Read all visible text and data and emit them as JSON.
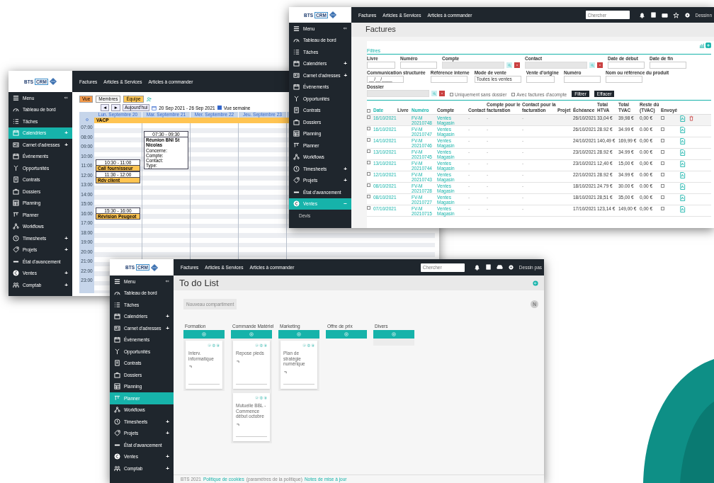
{
  "windows": [
    {
      "kind": "calendar",
      "logo": [
        "BTS",
        "CRM"
      ],
      "nav": [
        "Factures",
        "Articles & Services",
        "Articles à commander"
      ],
      "sidebar": {
        "menu_label": "Menu",
        "items": [
          {
            "label": "Tableau de bord",
            "selected": false
          },
          {
            "label": "Tâches",
            "selected": false
          },
          {
            "label": "Calendriers",
            "toggle": "+",
            "selected": true
          },
          {
            "label": "Carnet d'adresses",
            "toggle": "+",
            "selected": false
          },
          {
            "label": "Événements",
            "selected": false
          },
          {
            "label": "Opportunités",
            "selected": false
          },
          {
            "label": "Contrats",
            "selected": false
          },
          {
            "label": "Dossiers",
            "selected": false
          },
          {
            "label": "Planning",
            "selected": false
          },
          {
            "label": "Planner",
            "selected": false
          },
          {
            "label": "Workflows",
            "selected": false
          },
          {
            "label": "Timesheets",
            "toggle": "+",
            "selected": false
          },
          {
            "label": "Projets",
            "toggle": "+",
            "selected": false
          },
          {
            "label": "État d'avancement",
            "selected": false
          },
          {
            "label": "Ventes",
            "toggle": "+",
            "selected": false
          },
          {
            "label": "Comptab",
            "toggle": "+",
            "selected": false
          }
        ]
      },
      "calendar": {
        "views": [
          {
            "label": "Vue",
            "color": "#f59a4a"
          },
          {
            "label": "Membres",
            "color": "#ffffff"
          },
          {
            "label": "Équipe",
            "color": "#ffc857"
          }
        ],
        "prev": "◄",
        "next": "►",
        "today": "Aujourd'hui",
        "range": "20 Sep 2021 - 26 Sep 2021",
        "week_toggle": {
          "label": "Vue semaine",
          "checked": true
        },
        "days": [
          {
            "label": "Lun. Septembre 20",
            "events": [
              {
                "time": "10:30 - 11:00",
                "title": "Call fournisseur"
              },
              {
                "time": "11:30 - 12:00",
                "title": "Rdv client"
              },
              {
                "time": "15:30 - 16:00",
                "title": "Révision Peugeot"
              }
            ]
          },
          {
            "label": "Mar. Septembre 21",
            "events": [
              {
                "time": "07:30 - 09:30",
                "title": "Réunion BNI St Nicolas",
                "details": [
                  "Concerne:",
                  "Compte:",
                  "Contact:",
                  "Type:"
                ]
              }
            ]
          },
          {
            "label": "Mer. Septembre 22"
          },
          {
            "label": "Jeu. Septembre 23"
          }
        ],
        "all_day": "VACP",
        "times": [
          "07:00",
          "08:00",
          "09:00",
          "10:00",
          "11:00",
          "12:00",
          "13:00",
          "14:00",
          "15:00",
          "16:00",
          "17:00",
          "18:00",
          "19:00",
          "20:00",
          "21:00",
          "22:00",
          "23:00"
        ]
      }
    },
    {
      "kind": "invoices",
      "logo": [
        "BTS",
        "CRM"
      ],
      "nav": [
        "Factures",
        "Articles & Services",
        "Articles à commander"
      ],
      "search": {
        "placeholder": "Chercher"
      },
      "image_alt": "Dessinn",
      "sidebar": {
        "menu_label": "Menu",
        "items": [
          {
            "label": "Tableau de bord",
            "selected": false
          },
          {
            "label": "Tâches",
            "selected": false
          },
          {
            "label": "Calendriers",
            "toggle": "+",
            "selected": false
          },
          {
            "label": "Carnet d'adresses",
            "toggle": "+",
            "selected": false
          },
          {
            "label": "Événements",
            "selected": false
          },
          {
            "label": "Opportunités",
            "selected": false
          },
          {
            "label": "Contrats",
            "selected": false
          },
          {
            "label": "Dossiers",
            "selected": false
          },
          {
            "label": "Planning",
            "selected": false
          },
          {
            "label": "Planner",
            "selected": false
          },
          {
            "label": "Workflows",
            "selected": false
          },
          {
            "label": "Timesheets",
            "toggle": "+",
            "selected": false
          },
          {
            "label": "Projets",
            "toggle": "+",
            "selected": false
          },
          {
            "label": "État d'avancement",
            "selected": false
          },
          {
            "label": "Ventes",
            "toggle": "−",
            "selected": true,
            "children": [
              {
                "label": "Devis",
                "selected": false
              }
            ]
          }
        ]
      },
      "title": "Factures",
      "filters_title": "Filtres",
      "filters": [
        [
          {
            "label": "Livre",
            "kind": "select"
          },
          {
            "label": "Numéro",
            "kind": "text"
          },
          {
            "label": "Compte",
            "kind": "lookup"
          },
          {
            "label": "Contact",
            "kind": "lookup"
          },
          {
            "label": "Date de début",
            "kind": "text"
          },
          {
            "label": "Date de fin",
            "kind": "text"
          }
        ],
        [
          {
            "label": "Communication structurée",
            "kind": "text",
            "value": "__/__/____"
          },
          {
            "label": "Référence interne",
            "kind": "text"
          },
          {
            "label": "Mode de vente",
            "kind": "select",
            "value": "Toutes les ventes"
          },
          {
            "label": "Vente d'origine",
            "kind": "select"
          },
          {
            "label": "Numéro",
            "kind": "text"
          },
          {
            "label": "Nom ou référence du produit",
            "kind": "text"
          }
        ],
        [
          {
            "label": "Dossier",
            "kind": "lookup"
          }
        ]
      ],
      "options": [
        {
          "label": "Uniquement sans dossier",
          "checked": false
        },
        {
          "label": "Avec factures d'acompte",
          "checked": false
        }
      ],
      "buttons": [
        "Filtrer",
        "Effacer"
      ],
      "select_all": false,
      "columns": [
        {
          "label": "Date",
          "sortable": true
        },
        {
          "label": "Livre",
          "sortable": false
        },
        {
          "label": "Numéro",
          "sortable": true
        },
        {
          "label": "Compte",
          "sortable": false
        },
        {
          "label": "Contact",
          "sortable": false
        },
        {
          "label": "Compte pour le facturation",
          "sortable": false
        },
        {
          "label": "Contact pour la facturation",
          "sortable": false
        },
        {
          "label": "Projet",
          "sortable": false
        },
        {
          "label": "Échéance",
          "sortable": false
        },
        {
          "label": "Total HTVA",
          "sortable": false
        },
        {
          "label": "Total TVAC",
          "sortable": false
        },
        {
          "label": "Reste dû (TVAC)",
          "sortable": false
        },
        {
          "label": "Envoyé",
          "sortable": false
        }
      ],
      "rows": [
        {
          "cells": [
            "16/10/2021",
            "",
            "FV-M 20210748",
            "Ventes Magasin",
            "-",
            "-",
            "-",
            "",
            "26/10/2021",
            "33,04 €",
            "39,98 €",
            "0,00 €"
          ],
          "selected": false,
          "sent": false,
          "hovered": true
        },
        {
          "cells": [
            "16/10/2021",
            "",
            "FV-M 20210747",
            "Ventes Magasin",
            "-",
            "-",
            "-",
            "",
            "26/10/2021",
            "28.92 €",
            "34.99 €",
            "0.00 €"
          ],
          "selected": false,
          "sent": false,
          "hovered": false
        },
        {
          "cells": [
            "14/10/2021",
            "",
            "FV-M 20210746",
            "Ventes Magasin",
            "-",
            "-",
            "-",
            "",
            "24/10/2021",
            "140,49 €",
            "169,99 €",
            "0,00 €"
          ],
          "selected": false,
          "sent": false,
          "hovered": false
        },
        {
          "cells": [
            "13/10/2021",
            "",
            "FV-M 20210745",
            "Ventes Magasin",
            "-",
            "-",
            "-",
            "",
            "23/10/2021",
            "28.92 €",
            "34.99 €",
            "0.00 €"
          ],
          "selected": false,
          "sent": false,
          "hovered": false
        },
        {
          "cells": [
            "13/10/2021",
            "",
            "FV-M 20210744",
            "Ventes Magasin",
            "-",
            "-",
            "-",
            "",
            "23/10/2021",
            "12,40 €",
            "15,00 €",
            "0,00 €"
          ],
          "selected": false,
          "sent": false,
          "hovered": false
        },
        {
          "cells": [
            "12/10/2021",
            "",
            "FV-M 20210743",
            "Ventes Magasin",
            "-",
            "-",
            "-",
            "",
            "22/10/2021",
            "28.92 €",
            "34.99 €",
            "0.00 €"
          ],
          "selected": false,
          "sent": false,
          "hovered": false
        },
        {
          "cells": [
            "08/10/2021",
            "",
            "FV-M 20210728",
            "Ventes Magasin",
            "-",
            "-",
            "-",
            "",
            "18/10/2021",
            "24.79 €",
            "30.00 €",
            "0.00 €"
          ],
          "selected": false,
          "sent": false,
          "hovered": false
        },
        {
          "cells": [
            "08/10/2021",
            "",
            "FV-M 20210727",
            "Ventes Magasin",
            "-",
            "-",
            "-",
            "",
            "18/10/2021",
            "28,51 €",
            "35,00 €",
            "0,00 €"
          ],
          "selected": false,
          "sent": false,
          "hovered": false
        },
        {
          "cells": [
            "07/10/2021",
            "",
            "FV-M 20210715",
            "Ventes Magasin",
            "-",
            "-",
            "-",
            "",
            "17/10/2021",
            "123,14 €",
            "149,00 €",
            "0,00 €"
          ],
          "selected": false,
          "sent": false,
          "hovered": false
        }
      ]
    },
    {
      "kind": "todo",
      "logo": [
        "BTS",
        "CRM"
      ],
      "nav": [
        "Factures",
        "Articles & Services",
        "Articles à commander"
      ],
      "search": {
        "placeholder": "Chercher"
      },
      "image_alt": "Dessin pas",
      "sidebar": {
        "menu_label": "Menu",
        "items": [
          {
            "label": "Tableau de bord",
            "selected": false
          },
          {
            "label": "Tâches",
            "selected": false
          },
          {
            "label": "Calendriers",
            "toggle": "+",
            "selected": false
          },
          {
            "label": "Carnet d'adresses",
            "toggle": "+",
            "selected": false
          },
          {
            "label": "Événements",
            "selected": false
          },
          {
            "label": "Opportunités",
            "selected": false
          },
          {
            "label": "Contrats",
            "selected": false
          },
          {
            "label": "Dossiers",
            "selected": false
          },
          {
            "label": "Planning",
            "selected": false
          },
          {
            "label": "Planner",
            "selected": true
          },
          {
            "label": "Workflows",
            "selected": false
          },
          {
            "label": "Timesheets",
            "toggle": "+",
            "selected": false
          },
          {
            "label": "Projets",
            "toggle": "+",
            "selected": false
          },
          {
            "label": "État d'avancement",
            "selected": false
          },
          {
            "label": "Ventes",
            "toggle": "+",
            "selected": false
          },
          {
            "label": "Comptab",
            "toggle": "+",
            "selected": false
          }
        ]
      },
      "title": "To do List",
      "new_button": "Nouveau compartiment",
      "avatar": "N",
      "columns": [
        {
          "title": "Formation",
          "cards": [
            {
              "title": "Interv. informatique"
            }
          ]
        },
        {
          "title": "Commande Matériel",
          "cards": [
            {
              "title": "Repose pieds"
            },
            {
              "title": "Mutuelle BBL - Commence début octobre"
            }
          ]
        },
        {
          "title": "Marketing",
          "cards": [
            {
              "title": "Plan de stratégie numérique"
            }
          ]
        },
        {
          "title": "Offre de prix"
        },
        {
          "title": "Divers"
        }
      ],
      "footer": {
        "copyright": "BTS 2021",
        "link": "Politique de cookies",
        "note": "(paramètres de la politique)",
        "link2": "Notes de mise à jour"
      }
    }
  ]
}
